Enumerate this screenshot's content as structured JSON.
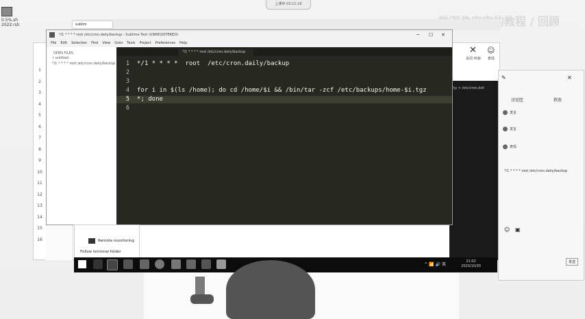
{
  "desktop": {
    "top_pill": "上课中 03:11:18",
    "watermark": "微图像密室的教程 / 回顾",
    "icon_label": "0.5%.sh 2022.rsh"
  },
  "back_window": {
    "tab_label": "sublim",
    "sidebar_line_numbers": [
      "1",
      "2",
      "3",
      "4",
      "5",
      "6",
      "7",
      "8",
      "9",
      "10",
      "11",
      "12",
      "13",
      "14",
      "15",
      "16"
    ],
    "right_tools": [
      {
        "icon": "x-close-icon",
        "label": "关闭 终端"
      },
      {
        "icon": "emoji-icon",
        "label": "表情"
      }
    ],
    "terminal_text": "/sy > /etc/cron.dsh"
  },
  "sublime": {
    "title": "*/1 * * * * root /etc/cron.daily/backup - Sublime Text (UNREGISTERED)",
    "menu": [
      "File",
      "Edit",
      "Selection",
      "Find",
      "View",
      "Goto",
      "Tools",
      "Project",
      "Preferences",
      "Help"
    ],
    "sidebar_header": "OPEN FILES",
    "sidebar_files": [
      "• untitled",
      "*/1 * * * * root /etc/cron.daily/backup"
    ],
    "tab_label": "*/1 * * * * root /etc/cron.daily/backup",
    "line_numbers": [
      "1",
      "2",
      "3",
      "4",
      "5",
      "6"
    ],
    "code_lines": [
      "*/1 * * * *  root  /etc/cron.daily/backup",
      "",
      "",
      "for i in $(ls /home); do cd /home/$i && /bin/tar -zcf /etc/backups/home-$i.tgz",
      "*; done",
      ""
    ]
  },
  "popup": {
    "row1": "Remote monitoring",
    "row2": "Follow terminal folder"
  },
  "taskbar": {
    "time": "21:02",
    "date": "2020/10/30",
    "tray": "^ 📶 🔊 英"
  },
  "right_panel": {
    "tabs": [
      "讨论区",
      "状态"
    ],
    "items": [
      "发言",
      "发言",
      "表情"
    ],
    "path": "*/1 * * * * root /etc/cron.daily/backup",
    "send_label": "发送"
  },
  "colors": {
    "editor_bg": "#272822",
    "taskbar_bg": "#0c0c0c",
    "code_fg": "#f8f8f2"
  }
}
